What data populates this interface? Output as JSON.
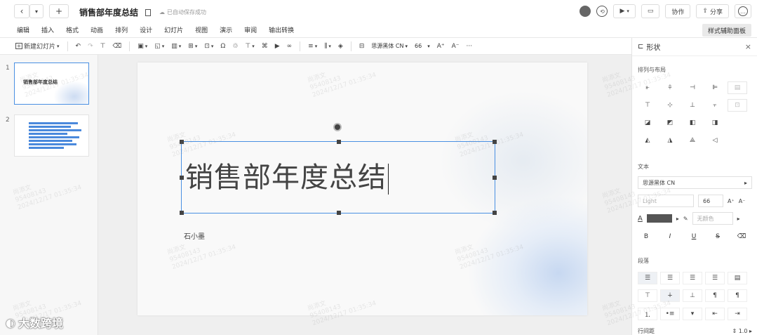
{
  "titlebar": {
    "back": "‹",
    "dropdown": "▾",
    "new_tab": "+",
    "doc_title": "销售部年度总结",
    "saved_status": "已自动保存成功",
    "history_icon": "history-icon",
    "play_label": "▶",
    "present_label": "▭",
    "collab_label": "协作",
    "share_label": "分享",
    "more_label": "…"
  },
  "menu": {
    "items": [
      "编辑",
      "插入",
      "格式",
      "动画",
      "排列",
      "设计",
      "幻灯片",
      "视图",
      "演示",
      "审阅",
      "输出转换"
    ],
    "right_panel_label": "样式辅助面板"
  },
  "toolbar": {
    "new_slide": "新建幻灯片",
    "font_name": "思源黑体 CN",
    "font_size": "66",
    "grow": "A⁺",
    "shrink": "A⁻",
    "more": "···"
  },
  "thumbs": [
    {
      "num": "1",
      "title": "销售部年度总结"
    },
    {
      "num": "2"
    }
  ],
  "slide": {
    "title": "销售部年度总结",
    "author": "石小墨"
  },
  "panel": {
    "header": "形状",
    "close": "×",
    "arrange_label": "排列与布局",
    "text_label": "文本",
    "font": "思源黑体 CN",
    "weight": "Light",
    "size": "66",
    "highlight": "无颜色",
    "bold": "B",
    "italic": "I",
    "underline": "U",
    "strike": "S",
    "paragraph_label": "段落",
    "line_spacing_label": "行间距",
    "line_spacing_value": "1.0"
  },
  "brand": "大数跨境",
  "watermark": "尚添文\n95408143\n2024/12/17 01:35:34"
}
